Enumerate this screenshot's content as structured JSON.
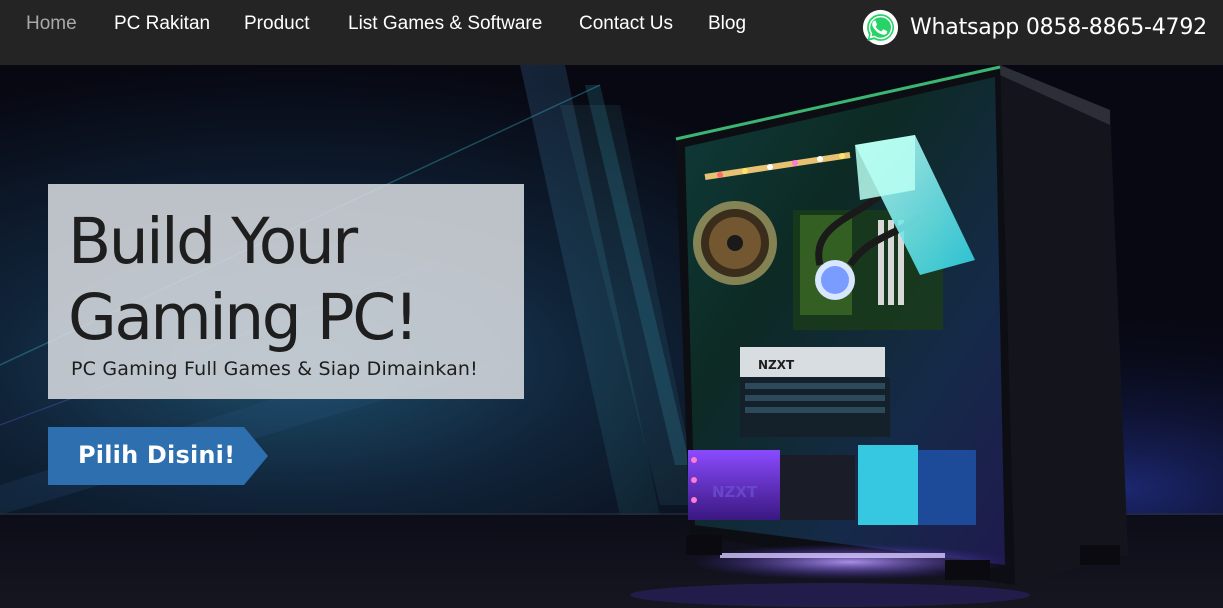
{
  "nav": {
    "items": [
      {
        "label": "Home",
        "active": true
      },
      {
        "label": "PC Rakitan",
        "active": false
      },
      {
        "label": "Product",
        "active": false
      },
      {
        "label": "List Games & Software",
        "active": false
      },
      {
        "label": "Contact Us",
        "active": false
      },
      {
        "label": "Blog",
        "active": false
      }
    ],
    "whatsapp": {
      "icon": "whatsapp-icon",
      "label": "Whatsapp 0858-8865-4792",
      "color": "#25d366"
    }
  },
  "hero": {
    "headline_line1": "Build Your",
    "headline_line2": "Gaming PC!",
    "subtitle": "PC Gaming Full Games & Siap Dimainkan!",
    "cta_label": "Pilih Disini!",
    "cta_color": "#2e6fb0",
    "case_brand_top": "NZXT",
    "case_brand_bottom": "NZXT"
  },
  "colors": {
    "nav_bg": "#242424",
    "nav_text": "#ffffff",
    "nav_active_text": "#a9a9a9"
  }
}
